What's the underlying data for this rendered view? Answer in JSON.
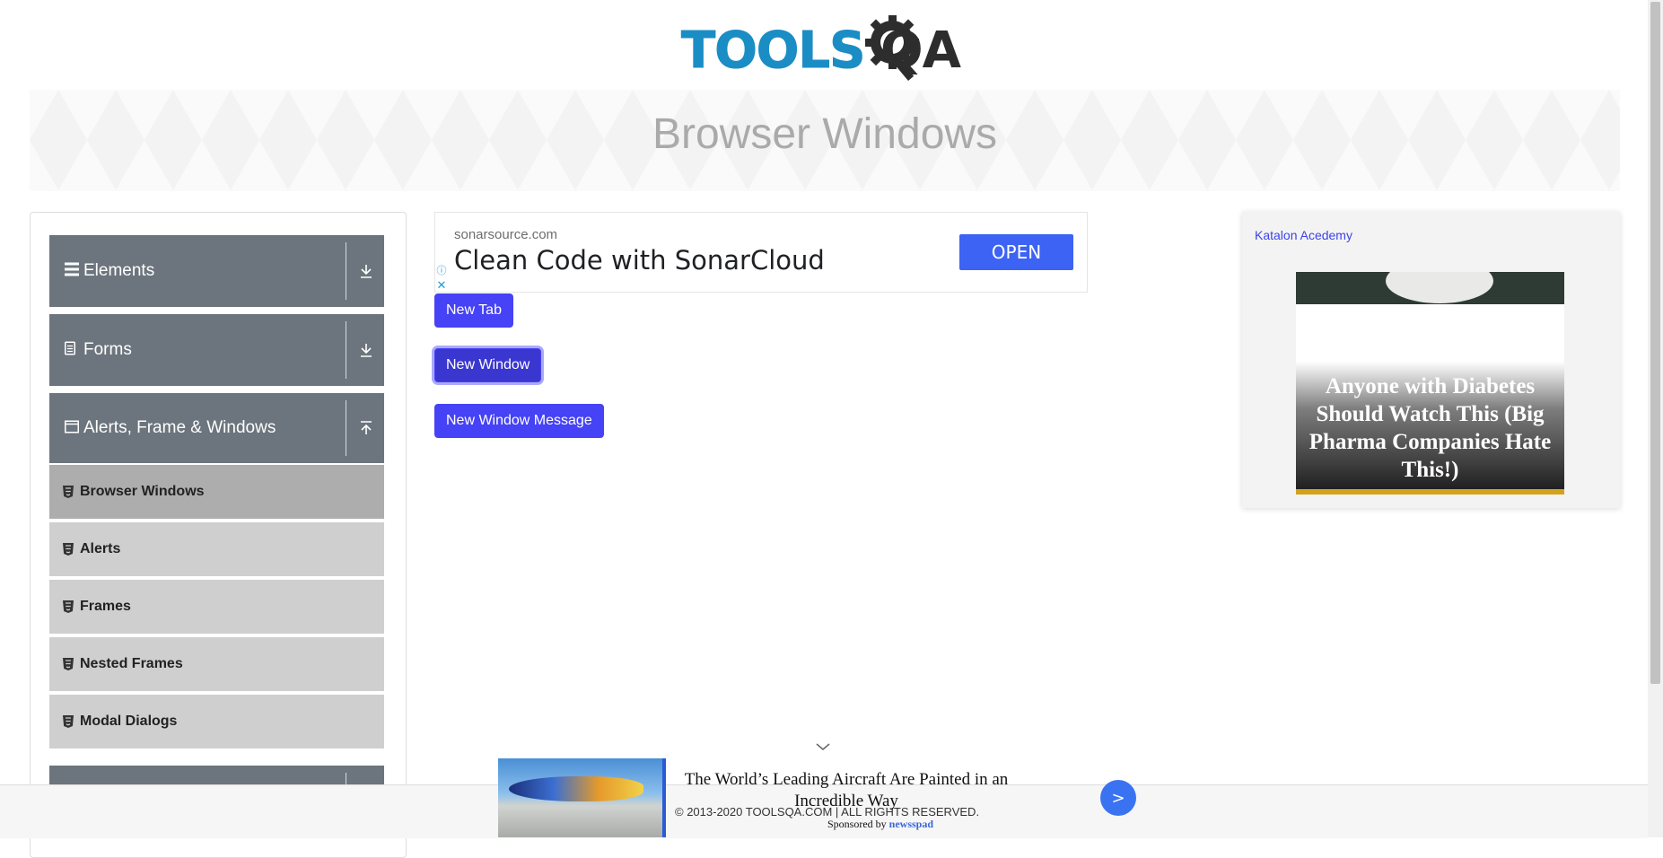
{
  "header": {
    "logo_left": "TOOLS",
    "logo_right": "QA"
  },
  "banner": {
    "title": "Browser Windows"
  },
  "sidebar": {
    "groups": [
      {
        "label": "Elements",
        "icon": "hamburger-icon",
        "expanded": false
      },
      {
        "label": "Forms",
        "icon": "document-icon",
        "expanded": false
      },
      {
        "label": "Alerts, Frame & Windows",
        "icon": "window-icon",
        "expanded": true
      }
    ],
    "items": [
      {
        "label": "Browser Windows",
        "active": true
      },
      {
        "label": "Alerts",
        "active": false
      },
      {
        "label": "Frames",
        "active": false
      },
      {
        "label": "Nested Frames",
        "active": false
      },
      {
        "label": "Modal Dialogs",
        "active": false
      }
    ]
  },
  "top_ad": {
    "domain": "sonarsource.com",
    "headline": "Clean Code with SonarCloud",
    "cta": "OPEN",
    "info": "ⓘ",
    "close": "✕"
  },
  "buttons": {
    "new_tab": "New Tab",
    "new_window": "New Window",
    "new_window_message": "New Window Message"
  },
  "right_ad": {
    "alt_text": "Katalon Acedemy",
    "text": "Anyone with Diabetes Should Watch This (Big Pharma Companies Hate This!)"
  },
  "bottom_ad": {
    "title": "The World’s Leading Aircraft Are Painted in an Incredible Way",
    "sponsor_prefix": "Sponsored by",
    "sponsor_brand": "newsspad",
    "next": ">"
  },
  "footer": {
    "copyright": "© 2013-2020 TOOLSQA.COM | ALL RIGHTS RESERVED."
  },
  "colors": {
    "primary": "#4642f5",
    "sidebar_group": "#6c757d",
    "sidebar_item": "#cfcfcf",
    "active_item": "#adadad",
    "logo_blue": "#1b8dc5"
  }
}
